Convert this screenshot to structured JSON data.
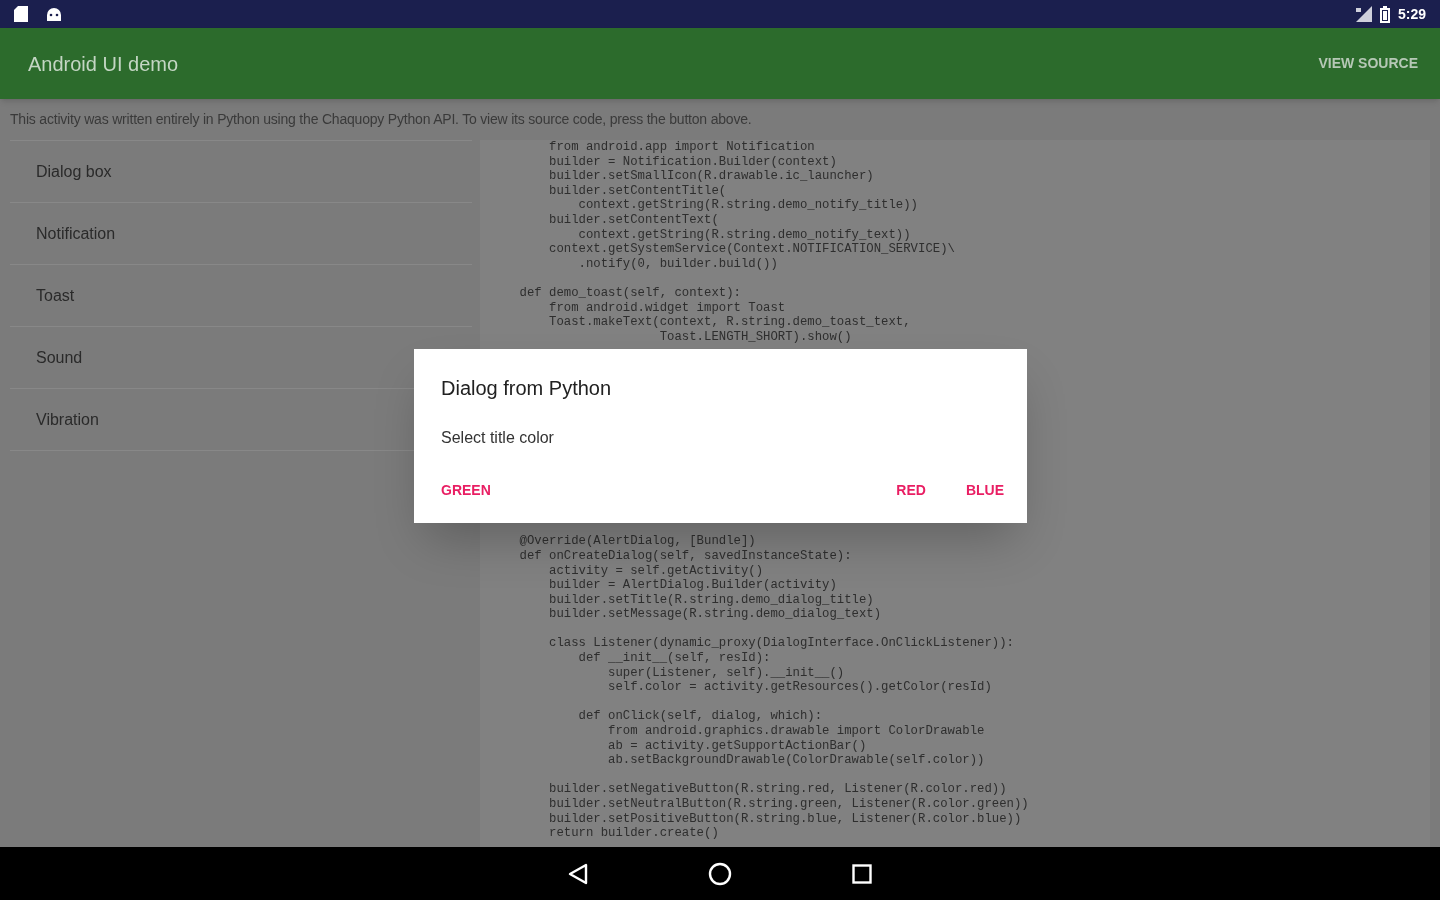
{
  "status_bar": {
    "time": "5:29"
  },
  "app_bar": {
    "title": "Android UI demo",
    "action": "VIEW SOURCE"
  },
  "description": "This activity was written entirely in Python using the Chaquopy Python API. To view its source code, press the button above.",
  "demos": [
    {
      "label": "Dialog box"
    },
    {
      "label": "Notification"
    },
    {
      "label": "Toast"
    },
    {
      "label": "Sound"
    },
    {
      "label": "Vibration"
    }
  ],
  "source_code": {
    "blocks": [
      [
        "        from android.app import Notification",
        "        builder = Notification.Builder(context)",
        "        builder.setSmallIcon(R.drawable.ic_launcher)",
        "        builder.setContentTitle(",
        "            context.getString(R.string.demo_notify_title))",
        "        builder.setContentText(",
        "            context.getString(R.string.demo_notify_text))",
        "        context.getSystemService(Context.NOTIFICATION_SERVICE)\\",
        "            .notify(0, builder.build())"
      ],
      [
        "    def demo_toast(self, context):",
        "        from android.widget import Toast",
        "        Toast.makeText(context, R.string.demo_toast_text,",
        "                       Toast.LENGTH_SHORT).show()"
      ],
      [
        "    @Override(AlertDialog, [Bundle])",
        "    def onCreateDialog(self, savedInstanceState):",
        "        activity = self.getActivity()",
        "        builder = AlertDialog.Builder(activity)",
        "        builder.setTitle(R.string.demo_dialog_title)",
        "        builder.setMessage(R.string.demo_dialog_text)"
      ],
      [
        "        class Listener(dynamic_proxy(DialogInterface.OnClickListener)):",
        "            def __init__(self, resId):",
        "                super(Listener, self).__init__()",
        "                self.color = activity.getResources().getColor(resId)"
      ],
      [
        "            def onClick(self, dialog, which):",
        "                from android.graphics.drawable import ColorDrawable",
        "                ab = activity.getSupportActionBar()",
        "                ab.setBackgroundDrawable(ColorDrawable(self.color))"
      ],
      [
        "        builder.setNegativeButton(R.string.red, Listener(R.color.red))",
        "        builder.setNeutralButton(R.string.green, Listener(R.color.green))",
        "        builder.setPositiveButton(R.string.blue, Listener(R.color.blue))",
        "        return builder.create()"
      ]
    ]
  },
  "dialog": {
    "title": "Dialog from Python",
    "message": "Select title color",
    "left_buttons": [
      "GREEN"
    ],
    "right_buttons": [
      "RED",
      "BLUE"
    ]
  }
}
